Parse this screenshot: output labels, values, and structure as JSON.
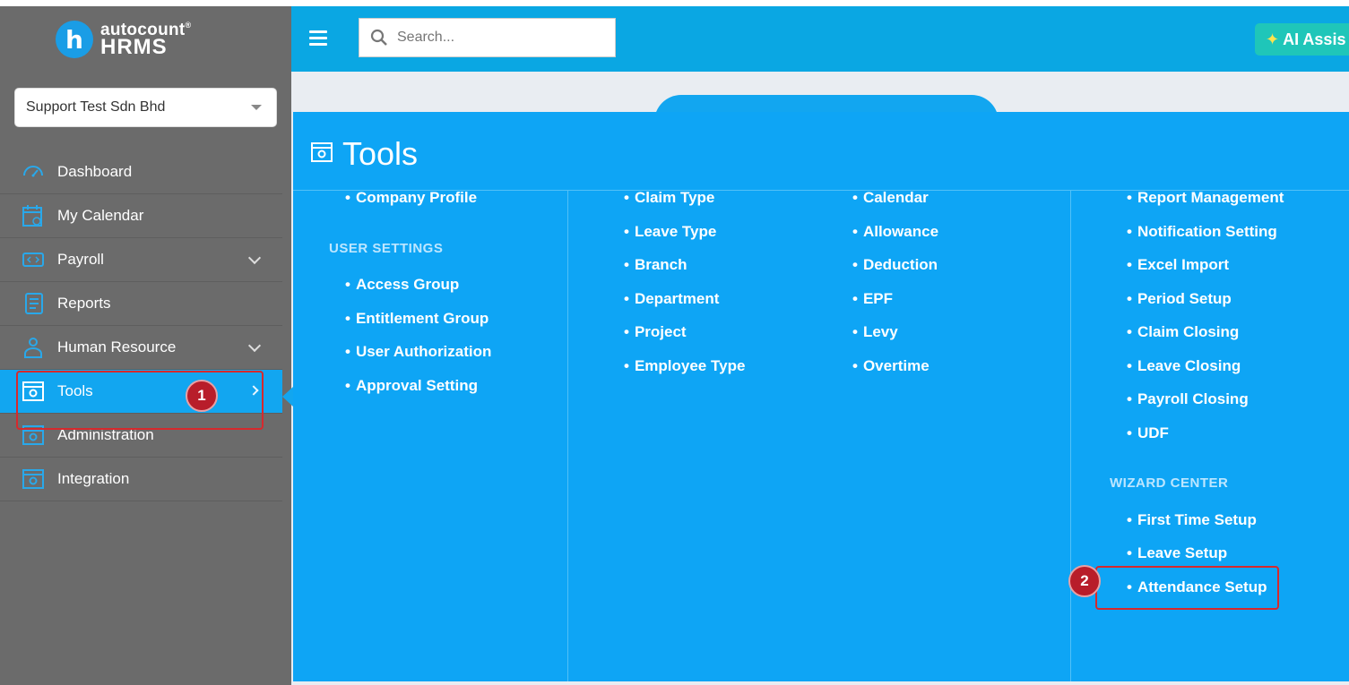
{
  "brand": {
    "top": "autocount",
    "mark": "®",
    "bottom": "HRMS",
    "badge": "h"
  },
  "company": {
    "selected": "Support Test Sdn Bhd"
  },
  "sidebar": {
    "items": [
      {
        "label": "Dashboard",
        "icon": "dashboard-icon"
      },
      {
        "label": "My Calendar",
        "icon": "calendar-icon"
      },
      {
        "label": "Payroll",
        "icon": "payroll-icon"
      },
      {
        "label": "Reports",
        "icon": "reports-icon"
      },
      {
        "label": "Human Resource",
        "icon": "human-resource-icon"
      },
      {
        "label": "Tools",
        "icon": "tools-icon"
      },
      {
        "label": "Administration",
        "icon": "administration-icon"
      },
      {
        "label": "Integration",
        "icon": "integration-icon"
      }
    ]
  },
  "search": {
    "placeholder": "Search..."
  },
  "ai_button": {
    "label": "AI Assis"
  },
  "tools": {
    "title": "Tools",
    "col1": {
      "items": [
        "Company Profile"
      ],
      "user_settings_heading": "USER SETTINGS",
      "user_settings": [
        "Access Group",
        "Entitlement Group",
        "User Authorization",
        "Approval Setting"
      ]
    },
    "col2": {
      "items": [
        "Claim Type",
        "Leave Type",
        "Branch",
        "Department",
        "Project",
        "Employee Type"
      ]
    },
    "col3": {
      "items": [
        "Calendar",
        "Allowance",
        "Deduction",
        "EPF",
        "Levy",
        "Overtime"
      ]
    },
    "col4": {
      "items": [
        "Report Management",
        "Notification Setting",
        "Excel Import",
        "Period Setup",
        "Claim Closing",
        "Leave Closing",
        "Payroll Closing",
        "UDF"
      ],
      "wizard_heading": "WIZARD CENTER",
      "wizard": [
        "First Time Setup",
        "Leave Setup",
        "Attendance Setup"
      ]
    }
  },
  "annotations": {
    "step1": "1",
    "step2": "2"
  },
  "colors": {
    "sidebar": "#6b6b6b",
    "active": "#12a6f0",
    "topbar": "#0aa7e3",
    "panel": "#0ea5f5",
    "annotation": "#d6292d"
  }
}
